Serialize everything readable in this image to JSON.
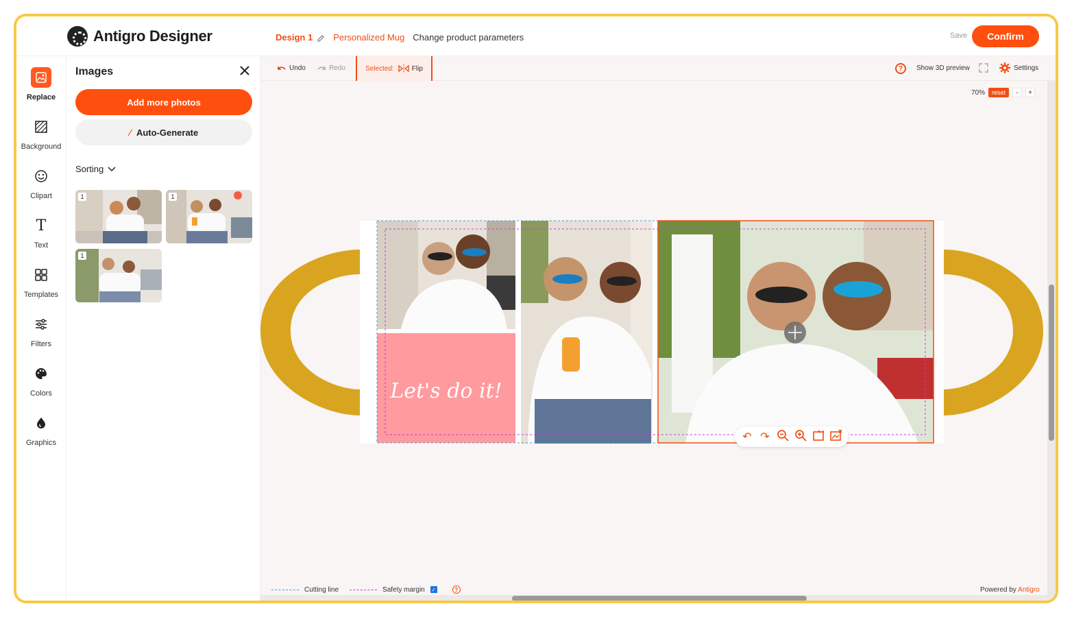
{
  "header": {
    "app_title": "Antigro Designer",
    "design_name": "Design 1",
    "product": "Personalized Mug",
    "params_link": "Change product parameters",
    "save_label": "Save",
    "confirm_label": "Confirm"
  },
  "rail": {
    "items": [
      {
        "label": "Replace",
        "icon": "image-replace-icon"
      },
      {
        "label": "Background",
        "icon": "pattern-icon"
      },
      {
        "label": "Clipart",
        "icon": "sticker-icon"
      },
      {
        "label": "Text",
        "icon": "text-icon"
      },
      {
        "label": "Templates",
        "icon": "grid-icon"
      },
      {
        "label": "Filters",
        "icon": "sliders-icon"
      },
      {
        "label": "Colors",
        "icon": "palette-icon"
      },
      {
        "label": "Graphics",
        "icon": "drop-icon"
      }
    ]
  },
  "panel": {
    "title": "Images",
    "add_photos": "Add more photos",
    "auto_generate": "Auto-Generate",
    "sorting": "Sorting",
    "thumbs": [
      {
        "count": "1"
      },
      {
        "count": "1"
      },
      {
        "count": "1"
      }
    ]
  },
  "toolbar": {
    "undo": "Undo",
    "redo": "Redo",
    "selected_label": "Selected:",
    "flip": "Flip",
    "show_3d": "Show 3D preview",
    "settings": "Settings"
  },
  "zoom": {
    "level": "70%",
    "reset": "reset",
    "minus": "-",
    "plus": "+"
  },
  "canvas": {
    "mug_color": "#d9a520",
    "text_overlay": "Let's do it!"
  },
  "legend": {
    "cutting_line": "Cutting line",
    "safety_margin": "Safety margin",
    "powered_by": "Powered by",
    "brand": "Antigro"
  },
  "colors": {
    "accent": "#ff4f0e",
    "frame": "#f7c948"
  }
}
